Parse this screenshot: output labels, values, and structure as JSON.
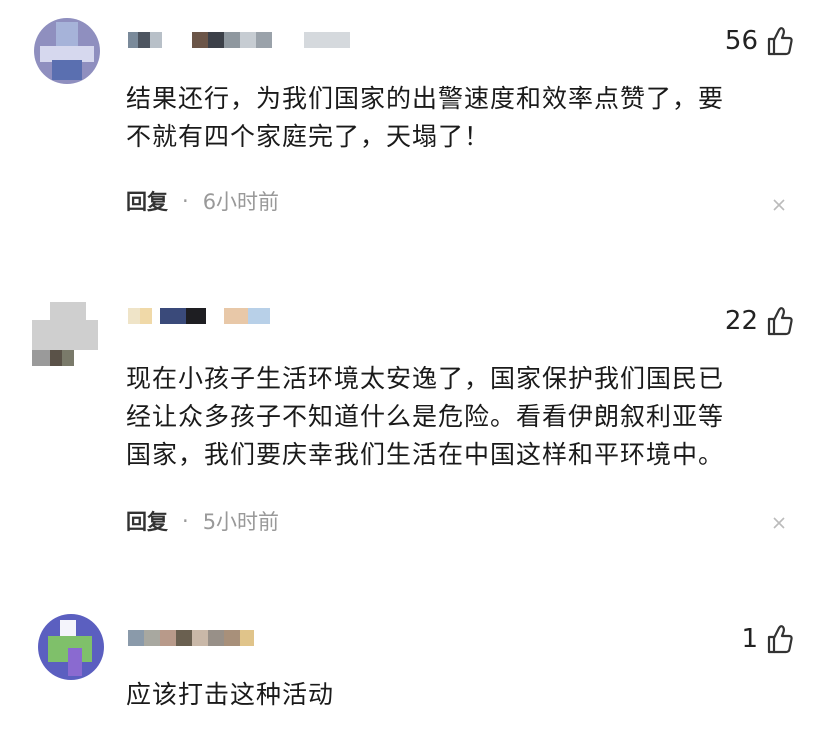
{
  "comments": [
    {
      "likes": "56",
      "text_lines": [
        "结果还行，为我们国家的出警速度和效率点赞了，要",
        "不就有四个家庭完了，天塌了！"
      ],
      "reply_label": "回复",
      "separator": "·",
      "time": "6小时前",
      "avatar_colors": [
        "#8f8fbf",
        "#a6b3d9",
        "#d6d8ee",
        "#5a6fb0"
      ],
      "name_colors": [
        "#7a8a9a",
        "#4d5560",
        "#b8c0c8",
        "#6b5548",
        "#3c4048",
        "#8f989f",
        "#c6ccd2",
        "#9aa2aa",
        "#d5d9dd"
      ]
    },
    {
      "likes": "22",
      "text_lines": [
        "现在小孩子生活环境太安逸了，国家保护我们国民已",
        "经让众多孩子不知道什么是危险。看看伊朗叙利亚等",
        "国家，我们要庆幸我们生活在中国这样和平环境中。"
      ],
      "reply_label": "回复",
      "separator": "·",
      "time": "5小时前",
      "avatar_colors": [
        "#cfcfcf",
        "#9a9a9a",
        "#5a5248",
        "#7a7a6a"
      ],
      "name_colors": [
        "#efe4c8",
        "#f0d9a8",
        "#3a4a7a",
        "#1e1e22",
        "#e8c8a8",
        "#b8d0e8"
      ]
    },
    {
      "likes": "1",
      "text_lines": [
        "应该打击这种活动"
      ],
      "reply_label": "",
      "separator": "",
      "time": "",
      "avatar_colors": [
        "#5b5fc0",
        "#7fc06a",
        "#f4f4fb",
        "#8a6ad0"
      ],
      "name_colors": [
        "#8a9aaa",
        "#a8a8a0",
        "#b89a8a",
        "#6a6050",
        "#c9b8a8",
        "#989088",
        "#a8907a",
        "#e0c48a"
      ]
    }
  ],
  "icons": {
    "like": "thumbs-up-icon",
    "close": "close-icon"
  }
}
